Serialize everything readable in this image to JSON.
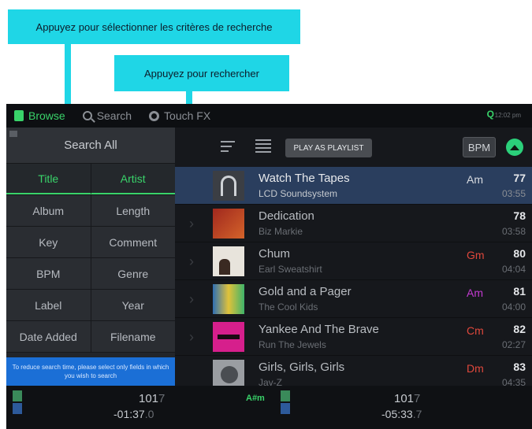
{
  "callouts": {
    "select_criteria": "Appuyez pour sélectionner les critères de recherche",
    "search": "Appuyez pour rechercher"
  },
  "colors": {
    "accent_green": "#39d36a",
    "callout_cyan": "#1fd6e6",
    "info_blue": "#1b6fd6",
    "current_row": "#2a3e5e"
  },
  "topbar": {
    "tabs": [
      {
        "label": "Browse",
        "icon": "folder-icon",
        "active": true
      },
      {
        "label": "Search",
        "icon": "search-icon",
        "active": false
      },
      {
        "label": "Touch FX",
        "icon": "touch-fx-icon",
        "active": false
      }
    ],
    "clock": "12:02 pm",
    "q_label": "Q"
  },
  "search_panel": {
    "search_all": "Search All",
    "criteria": [
      [
        "Title",
        "Artist"
      ],
      [
        "Album",
        "Length"
      ],
      [
        "Key",
        "Comment"
      ],
      [
        "BPM",
        "Genre"
      ],
      [
        "Label",
        "Year"
      ],
      [
        "Date Added",
        "Filename"
      ]
    ],
    "selected": [
      "Title",
      "Artist"
    ],
    "info": "To reduce search time, please select only fields in which you wish to search"
  },
  "toolbar": {
    "play_as_playlist": "PLAY AS PLAYLIST",
    "bpm": "BPM"
  },
  "tracks": [
    {
      "title": "Watch The Tapes",
      "artist": "LCD Soundsystem",
      "key": "Am",
      "key_color": "#d8dbe0",
      "bpm": "77",
      "length": "03:55",
      "current": true
    },
    {
      "title": "Dedication",
      "artist": "Biz Markie",
      "key": "",
      "key_color": "#39d36a",
      "bpm": "78",
      "length": "03:58",
      "current": false
    },
    {
      "title": "Chum",
      "artist": "Earl Sweatshirt",
      "key": "Gm",
      "key_color": "#e0483c",
      "bpm": "80",
      "length": "04:04",
      "current": false
    },
    {
      "title": "Gold and a Pager",
      "artist": "The Cool Kids",
      "key": "Am",
      "key_color": "#c23ad0",
      "bpm": "81",
      "length": "04:00",
      "current": false
    },
    {
      "title": "Yankee And The Brave",
      "artist": "Run The Jewels",
      "key": "Cm",
      "key_color": "#e0483c",
      "bpm": "82",
      "length": "02:27",
      "current": false
    },
    {
      "title": "Girls, Girls, Girls",
      "artist": "Jay-Z",
      "key": "Dm",
      "key_color": "#e0483c",
      "bpm": "83",
      "length": "04:35",
      "current": false
    }
  ],
  "decks": {
    "left_bpm": "101",
    "left_bpm_dec": "7",
    "left_time": "-01:37",
    "left_time_dec": ".0",
    "left_key": "A#m",
    "right_bpm": "101",
    "right_bpm_dec": "7",
    "right_time": "-05:33",
    "right_time_dec": ".7"
  }
}
